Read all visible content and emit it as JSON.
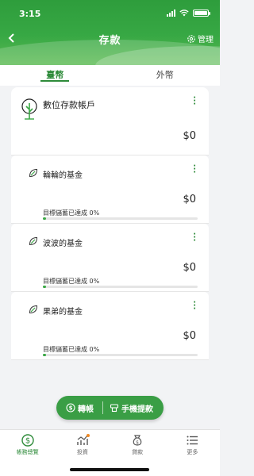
{
  "status": {
    "time": "3:15"
  },
  "header": {
    "title": "存款",
    "manage_label": "管理"
  },
  "tabs": [
    {
      "label": "臺幣",
      "active": true
    },
    {
      "label": "外幣",
      "active": false
    }
  ],
  "main_account": {
    "name": "數位存款帳戶",
    "amount": "$0"
  },
  "funds": [
    {
      "name": "輪輪的基金",
      "amount": "$0",
      "goal_text": "目標儲蓄已達成 0%",
      "progress": 0
    },
    {
      "name": "波波的基金",
      "amount": "$0",
      "goal_text": "目標儲蓄已達成 0%",
      "progress": 0
    },
    {
      "name": "果弟的基金",
      "amount": "$0",
      "goal_text": "目標儲蓄已達成 0%",
      "progress": 0
    }
  ],
  "fab": {
    "transfer_label": "轉帳",
    "withdraw_label": "手機提款"
  },
  "bottom_nav": [
    {
      "label": "帳務總覽",
      "icon": "dollar-circle-icon",
      "active": true
    },
    {
      "label": "投資",
      "icon": "chart-icon",
      "active": false
    },
    {
      "label": "貸款",
      "icon": "loan-bag-icon",
      "active": false
    },
    {
      "label": "更多",
      "icon": "menu-list-icon",
      "active": false
    }
  ],
  "colors": {
    "brand_green": "#2e8b3a",
    "header_green": "#37a844",
    "badge_orange": "#f08a24"
  }
}
